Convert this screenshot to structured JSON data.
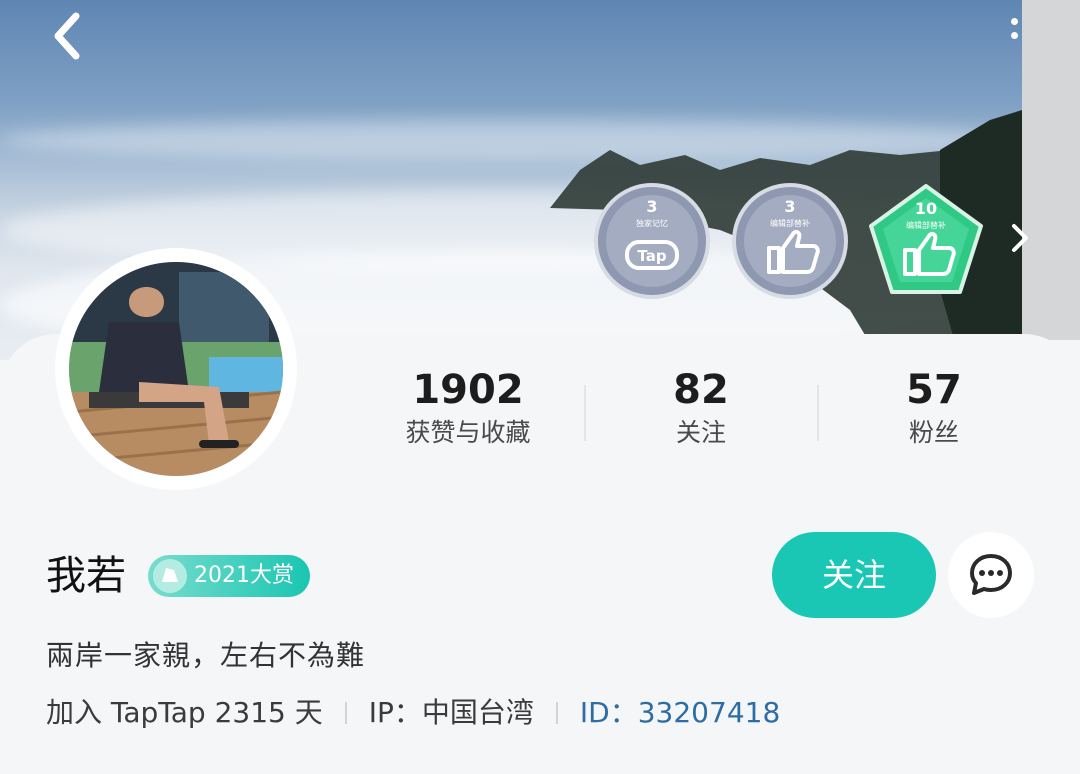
{
  "stats": [
    {
      "value": "1902",
      "label": "获赞与收藏"
    },
    {
      "value": "82",
      "label": "关注"
    },
    {
      "value": "57",
      "label": "粉丝"
    }
  ],
  "badges": [
    {
      "count": "3",
      "caption": "独家记忆",
      "mark": "Tap"
    },
    {
      "count": "3",
      "caption": "编辑部替补"
    },
    {
      "count": "10",
      "caption": "编辑部替补"
    }
  ],
  "profile": {
    "name": "我若",
    "tag": "2021大赏",
    "bio": "兩岸一家親，左右不為難",
    "join_text": "加入 TapTap 2315 天",
    "ip_text": "IP：中国台湾",
    "id_text": "ID：33207418"
  },
  "actions": {
    "follow_label": "关注"
  },
  "icons": [
    "back-arrow-icon",
    "more-dots-icon",
    "chevron-right-icon",
    "message-bubble-icon"
  ],
  "colors": {
    "accent": "#19c7b4",
    "id_link": "#2e6da4"
  }
}
